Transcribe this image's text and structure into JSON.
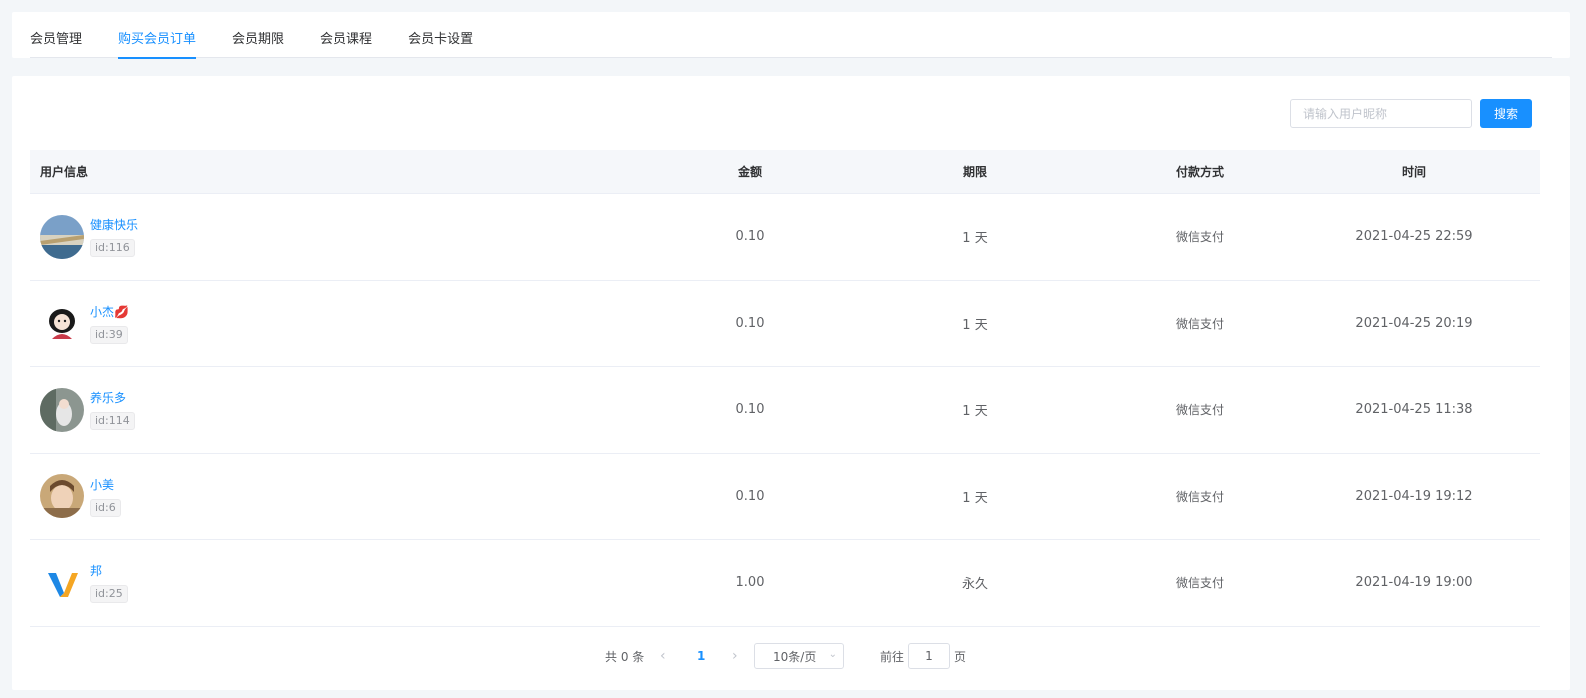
{
  "tabs": [
    {
      "label": "会员管理",
      "active": false
    },
    {
      "label": "购买会员订单",
      "active": true
    },
    {
      "label": "会员期限",
      "active": false
    },
    {
      "label": "会员课程",
      "active": false
    },
    {
      "label": "会员卡设置",
      "active": false
    }
  ],
  "search": {
    "placeholder": "请输入用户昵称",
    "button_label": "搜索"
  },
  "table": {
    "headers": {
      "user": "用户信息",
      "amount": "金额",
      "period": "期限",
      "pay": "付款方式",
      "time": "时间"
    },
    "rows": [
      {
        "name": "健康快乐",
        "id": "id:116",
        "amount": "0.10",
        "period": "1 天",
        "pay": "微信支付",
        "time": "2021-04-25 22:59",
        "avatar": "landscape"
      },
      {
        "name": "小杰💋",
        "id": "id:39",
        "amount": "0.10",
        "period": "1 天",
        "pay": "微信支付",
        "time": "2021-04-25 20:19",
        "avatar": "cartoon-girl"
      },
      {
        "name": "养乐多",
        "id": "id:114",
        "amount": "0.10",
        "period": "1 天",
        "pay": "微信支付",
        "time": "2021-04-25 11:38",
        "avatar": "photo-gray"
      },
      {
        "name": "小美",
        "id": "id:6",
        "amount": "0.10",
        "period": "1 天",
        "pay": "微信支付",
        "time": "2021-04-19 19:12",
        "avatar": "photo-warm"
      },
      {
        "name": "邦",
        "id": "id:25",
        "amount": "1.00",
        "period": "永久",
        "pay": "微信支付",
        "time": "2021-04-19 19:00",
        "avatar": "v-logo"
      }
    ]
  },
  "pagination": {
    "total_text": "共 0 条",
    "prev_icon": "chevron-left-icon",
    "current_page": "1",
    "next_icon": "chevron-right-icon",
    "page_size": "10条/页",
    "goto_label": "前往",
    "jump_value": "1",
    "page_suffix": "页"
  },
  "colors": {
    "accent": "#1890ff",
    "background": "#f3f6f9"
  }
}
